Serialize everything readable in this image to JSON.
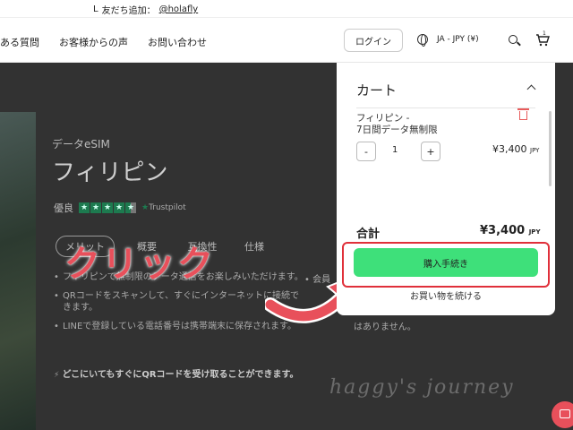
{
  "topbar": {
    "line_text": "友だち追加：",
    "handle": "@holafly"
  },
  "nav": {
    "links": [
      "ある質問",
      "お客様からの声",
      "お問い合わせ"
    ],
    "login": "ログイン",
    "language": "JA - JPY (¥)",
    "cart_count": "1"
  },
  "product": {
    "subtitle": "データeSIM",
    "title": "フィリピン",
    "rating_label": "優良",
    "rating_stars": 4.5,
    "rating_provider": "Trustpilot",
    "tabs": [
      "メリット",
      "概要",
      "互換性",
      "仕様"
    ],
    "bullets": [
      "フィリピンで無制限のデータ通信をお楽しみいただけます。",
      "QRコードをスキャンして、すぐにインターネットに接続できます。",
      "LINEで登録している電話番号は携帯端末に保存されます。"
    ],
    "bullet_right": "会員",
    "note_right": "はありません。",
    "bottom_note": "どこにいてもすぐにQRコードを受け取ることができます。"
  },
  "cart": {
    "title": "カート",
    "item_name_line1": "フィリピン -",
    "item_name_line2": "7日間データ無制限",
    "qty_minus": "-",
    "qty_value": "1",
    "qty_plus": "+",
    "item_price": "¥3,400",
    "currency": "JPY",
    "total_label": "合計",
    "total_value": "¥3,400",
    "checkout": "購入手続き",
    "continue": "お買い物を続ける"
  },
  "annotation": {
    "click_text": "クリック",
    "watermark": "haggy's journey"
  },
  "colors": {
    "accent_green": "#3ee07a",
    "highlight_red": "#e0303a",
    "annotation_red": "#e8505b"
  }
}
